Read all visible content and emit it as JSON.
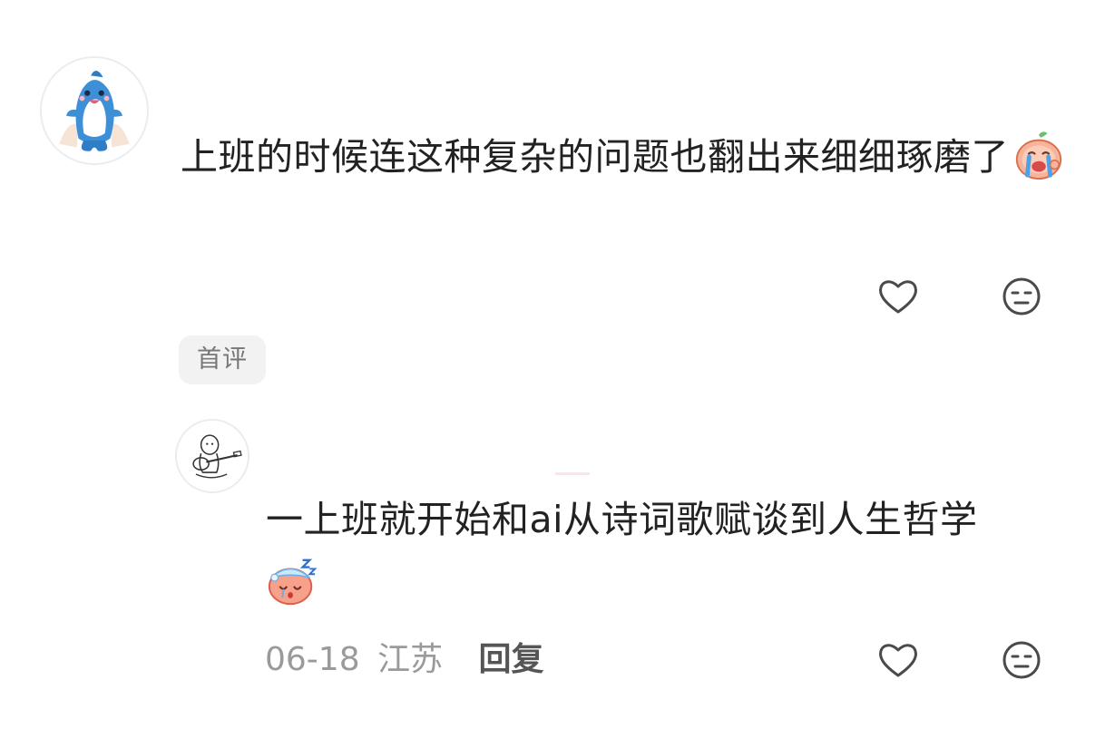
{
  "comments": [
    {
      "avatar_icon": "dolphin-avatar-icon",
      "text": "上班的时候连这种复杂的问题也翻出来细细琢磨了",
      "sticker_icon": "crying-peach-sticker-icon",
      "badge": "首评"
    }
  ],
  "reply": {
    "avatar_icon": "guitar-sketch-avatar-icon",
    "text": "一上班就开始和ai从诗词歌赋谈到人生哲学",
    "sticker_icon": "sleepy-peach-sticker-icon",
    "date": "06-18",
    "location": "江苏",
    "reply_label": "回复"
  },
  "icons": {
    "like": "heart-outline-icon",
    "dislike": "neutral-face-icon"
  },
  "colors": {
    "text": "#222222",
    "meta": "#9a9a9a",
    "badge_bg": "#f2f2f2",
    "icon_stroke": "#4a4a4a",
    "sticker_peach": "#f6a58a",
    "avatar_blue": "#3d8fd8"
  }
}
